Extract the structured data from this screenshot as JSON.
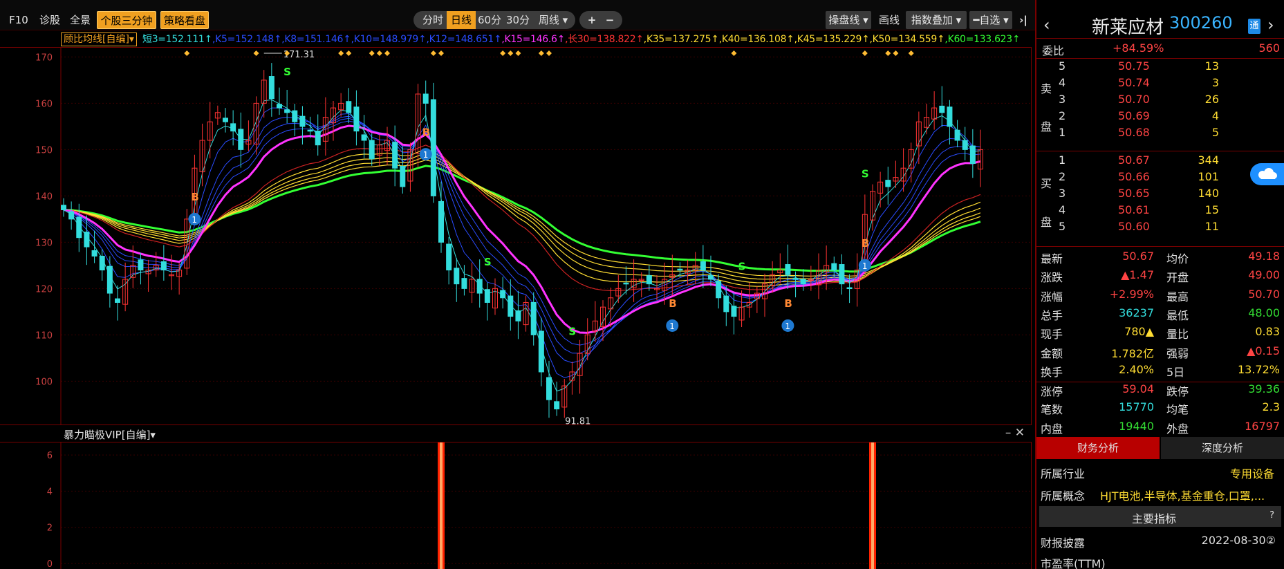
{
  "toolbar": {
    "left_buttons": [
      "F10",
      "诊股",
      "全景"
    ],
    "highlight_buttons": [
      "个股三分钟",
      "策略看盘"
    ],
    "periods": [
      "分时",
      "日线",
      "60分",
      "30分",
      "周线 ▾"
    ],
    "active_period": "日线",
    "zoom": [
      "+",
      "−"
    ],
    "right_buttons": [
      "操盘线 ▾",
      "画线",
      "指数叠加 ▾",
      "━自选 ▾"
    ],
    "collapse_icon": "double-chevron-right-icon"
  },
  "indicator": {
    "name": "顾比均线[自编]▾",
    "values": [
      {
        "text": "短3=152.111↑",
        "color": "#33dddd"
      },
      {
        "text": ",K5=152.148↑",
        "color": "#2a4cff"
      },
      {
        "text": ",K8=151.146↑",
        "color": "#2a4cff"
      },
      {
        "text": ",K10=148.979↑",
        "color": "#2a4cff"
      },
      {
        "text": ",K12=148.651↑",
        "color": "#2a4cff"
      },
      {
        "text": ",K15=146.6↑",
        "color": "#ff33ff"
      },
      {
        "text": ",长30=138.822↑",
        "color": "#ff3333"
      },
      {
        "text": ",K35=137.275↑",
        "color": "#ffdd33"
      },
      {
        "text": ",K40=136.108↑",
        "color": "#ffdd33"
      },
      {
        "text": ",K45=135.229↑",
        "color": "#ffdd33"
      },
      {
        "text": ",K50=134.559↑",
        "color": "#ffdd33"
      },
      {
        "text": ",K60=133.623↑",
        "color": "#33ff33"
      }
    ]
  },
  "chart_data": {
    "type": "candlestick",
    "y_ticks": [
      170,
      160,
      150,
      140,
      130,
      120,
      110,
      100
    ],
    "ylim": [
      90.5,
      172
    ],
    "high_label": "171.31",
    "low_label": "91.81",
    "colors": {
      "up": "#ff3333",
      "down": "#33dddd",
      "short": "#33dddd",
      "k5": "#2a4cff",
      "k15": "#ff33ff",
      "k30": "#cc2222",
      "k35": "#ffdd33",
      "k60": "#33ff33"
    },
    "closes": [
      137,
      135,
      131,
      129,
      127,
      124,
      119,
      117,
      122,
      125,
      124,
      124,
      125,
      124,
      123,
      124,
      135,
      146,
      152,
      156,
      158,
      156,
      154,
      150,
      152,
      160,
      165,
      161,
      159,
      158,
      156,
      155,
      154,
      151,
      157,
      159,
      160,
      158,
      154,
      152,
      148,
      151,
      152,
      146,
      142,
      150,
      162,
      160,
      140,
      130,
      124,
      121,
      120,
      122,
      119,
      117,
      120,
      118,
      114,
      113,
      117,
      110,
      102,
      96,
      94,
      99,
      102,
      106,
      110,
      113,
      116,
      118,
      120,
      121,
      122,
      122,
      121,
      120,
      122,
      123,
      124,
      124,
      125,
      124,
      122,
      118,
      115,
      114,
      116,
      117,
      119,
      121,
      123,
      124,
      123,
      122,
      121,
      122,
      124,
      125,
      124,
      121,
      120,
      124,
      136,
      141,
      143,
      142,
      144,
      146,
      150,
      156,
      157,
      159,
      158,
      155,
      152,
      150,
      147,
      150
    ],
    "sell_signals_S": [
      29,
      55,
      66,
      88,
      104
    ],
    "buy_signals_B": [
      17,
      47,
      63,
      79,
      94,
      104
    ],
    "sub_chart": {
      "name": "暴力瞄极VIP[自编]▾",
      "y_ticks": [
        6,
        4,
        2,
        0
      ],
      "bars_at": [
        49,
        105
      ]
    }
  },
  "panel": {
    "stock_name": "新莱应材",
    "stock_code": "300260",
    "badge": "通",
    "prev_icon": "chevron-left-icon",
    "next_icon": "chevron-right-icon",
    "weibi": {
      "label": "委比",
      "pct": "+84.59%",
      "val": "560"
    },
    "sell_label": [
      "卖",
      "盘"
    ],
    "buy_label": [
      "买",
      "盘"
    ],
    "asks": [
      {
        "lvl": "5",
        "price": "50.75",
        "vol": "13"
      },
      {
        "lvl": "4",
        "price": "50.74",
        "vol": "3"
      },
      {
        "lvl": "3",
        "price": "50.70",
        "vol": "26"
      },
      {
        "lvl": "2",
        "price": "50.69",
        "vol": "4"
      },
      {
        "lvl": "1",
        "price": "50.68",
        "vol": "5"
      }
    ],
    "bids": [
      {
        "lvl": "1",
        "price": "50.67",
        "vol": "344"
      },
      {
        "lvl": "2",
        "price": "50.66",
        "vol": "101"
      },
      {
        "lvl": "3",
        "price": "50.65",
        "vol": "140"
      },
      {
        "lvl": "4",
        "price": "50.61",
        "vol": "15"
      },
      {
        "lvl": "5",
        "price": "50.60",
        "vol": "11"
      }
    ],
    "stats": [
      {
        "k1": "最新",
        "v1": "50.67",
        "c1": "r",
        "k2": "均价",
        "v2": "49.18",
        "c2": "r"
      },
      {
        "k1": "涨跌",
        "v1": "▲1.47",
        "c1": "r",
        "k2": "开盘",
        "v2": "49.00",
        "c2": "r"
      },
      {
        "k1": "涨幅",
        "v1": "+2.99%",
        "c1": "r",
        "k2": "最高",
        "v2": "50.70",
        "c2": "r"
      },
      {
        "k1": "总手",
        "v1": "36237",
        "c1": "c",
        "k2": "最低",
        "v2": "48.00",
        "c2": "g"
      },
      {
        "k1": "现手",
        "v1": "780▲",
        "c1": "y",
        "k2": "量比",
        "v2": "0.83",
        "c2": "y"
      },
      {
        "k1": "金额",
        "v1": "1.782亿",
        "c1": "y",
        "k2": "强弱",
        "v2": "▲0.15",
        "c2": "r"
      },
      {
        "k1": "换手",
        "v1": "2.40%",
        "c1": "y",
        "k2": "5日",
        "v2": "13.72%",
        "c2": "y"
      },
      {
        "k1": "涨停",
        "v1": "59.04",
        "c1": "r",
        "k2": "跌停",
        "v2": "39.36",
        "c2": "g"
      },
      {
        "k1": "笔数",
        "v1": "15770",
        "c1": "c",
        "k2": "均笔",
        "v2": "2.3",
        "c2": "y"
      },
      {
        "k1": "内盘",
        "v1": "19440",
        "c1": "g",
        "k2": "外盘",
        "v2": "16797",
        "c2": "r"
      }
    ],
    "tabs": [
      "财务分析",
      "深度分析"
    ],
    "industry": {
      "label": "所属行业",
      "value": "专用设备"
    },
    "concept": {
      "label": "所属概念",
      "value": "HJT电池,半导体,基金重仓,口罩,..."
    },
    "main_indicator": "主要指标",
    "help": "?",
    "report": {
      "label": "财报披露",
      "value": "2022-08-30②"
    },
    "pe": {
      "label": "市盈率(TTM)"
    }
  }
}
